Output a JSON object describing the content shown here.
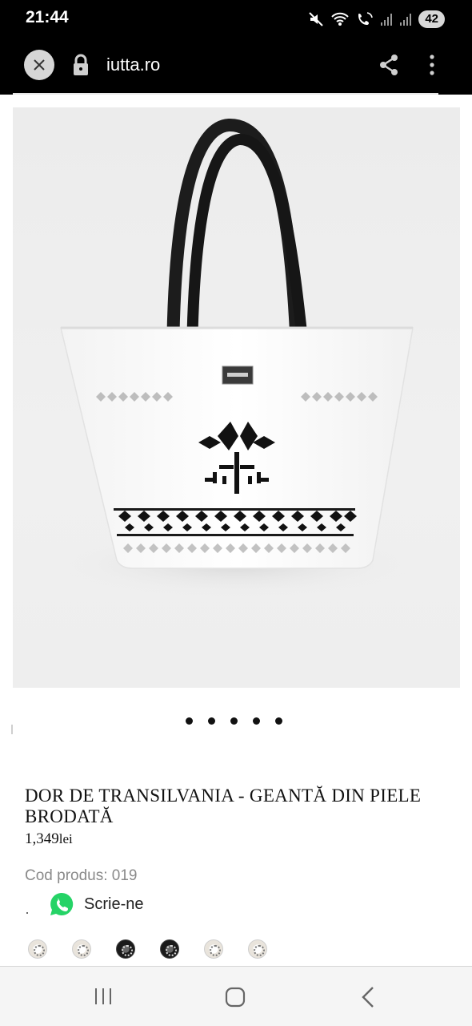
{
  "status_bar": {
    "time": "21:44",
    "battery": "42",
    "icons": [
      "mute-icon",
      "wifi-icon",
      "wifi-calling-icon",
      "signal-icon",
      "signal-icon"
    ]
  },
  "browser": {
    "url": "iutta.ro",
    "icons": [
      "close-icon",
      "lock-icon",
      "share-icon",
      "more-vert-icon"
    ]
  },
  "product": {
    "image_alt": "white leather tote bag with black embroidered traditional pattern",
    "carousel_dots": 5,
    "title": "DOR DE TRANSILVANIA - GEANTĂ DIN PIELE BRODATĂ",
    "price_value": "1,349",
    "price_currency": "lei",
    "sku": "Cod produs: 019",
    "whatsapp_label": "Scrie-ne",
    "swatches": [
      "light",
      "light",
      "dark",
      "dark",
      "light",
      "light"
    ]
  },
  "colors": {
    "status_bg": "#000000",
    "whatsapp_green": "#25d366",
    "nav_bg": "#f5f5f5"
  },
  "navigation": {
    "icons": [
      "recent-apps-icon",
      "home-icon",
      "back-icon"
    ]
  }
}
